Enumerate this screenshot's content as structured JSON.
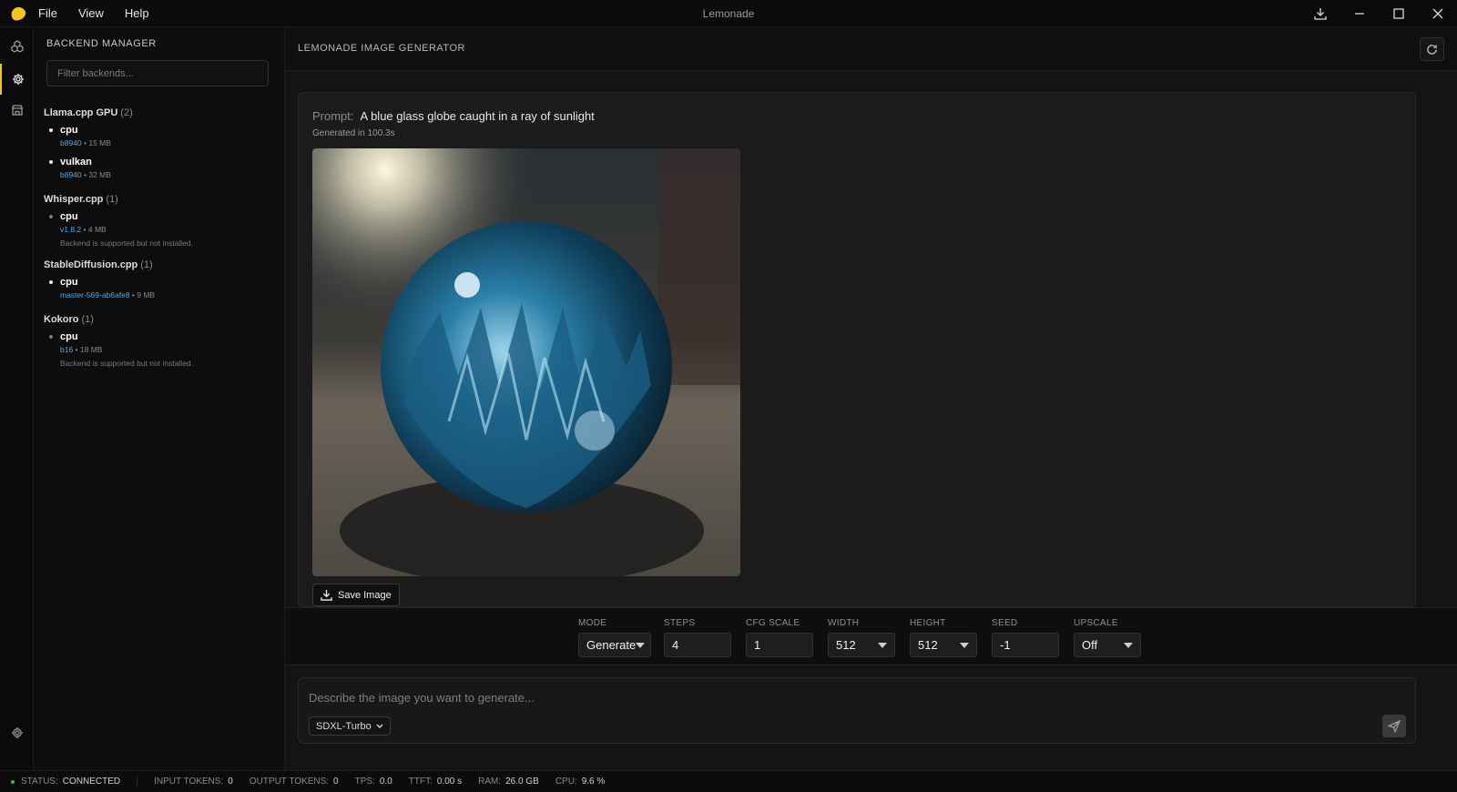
{
  "window": {
    "title": "Lemonade",
    "menu": [
      "File",
      "View",
      "Help"
    ]
  },
  "sidebar": {
    "title": "BACKEND MANAGER",
    "filter_placeholder": "Filter backends...",
    "groups": [
      {
        "name": "Llama.cpp GPU",
        "count": "(2)",
        "backends": [
          {
            "name": "cpu",
            "version": "b8940",
            "size": "15 MB",
            "installed": true,
            "note": ""
          },
          {
            "name": "vulkan",
            "version": "b8940",
            "size": "32 MB",
            "installed": true,
            "note": ""
          }
        ]
      },
      {
        "name": "Whisper.cpp",
        "count": "(1)",
        "backends": [
          {
            "name": "cpu",
            "version": "v1.8.2",
            "size": "4 MB",
            "installed": false,
            "note": "Backend is supported but not installed."
          }
        ]
      },
      {
        "name": "StableDiffusion.cpp",
        "count": "(1)",
        "backends": [
          {
            "name": "cpu",
            "version": "master-569-ab6afe8",
            "size": "9 MB",
            "installed": true,
            "note": ""
          }
        ]
      },
      {
        "name": "Kokoro",
        "count": "(1)",
        "backends": [
          {
            "name": "cpu",
            "version": "b16",
            "size": "18 MB",
            "installed": false,
            "note": "Backend is supported but not installed."
          }
        ]
      }
    ]
  },
  "main": {
    "title": "LEMONADE IMAGE GENERATOR",
    "prompt_label": "Prompt:",
    "prompt_text": "A blue glass globe caught in a ray of sunlight",
    "generated_time": "Generated in 100.3s",
    "save_label": "Save Image"
  },
  "controls": {
    "mode": {
      "label": "MODE",
      "value": "Generate"
    },
    "steps": {
      "label": "STEPS",
      "value": "4"
    },
    "cfg": {
      "label": "CFG SCALE",
      "value": "1"
    },
    "width": {
      "label": "WIDTH",
      "value": "512"
    },
    "height": {
      "label": "HEIGHT",
      "value": "512"
    },
    "seed": {
      "label": "SEED",
      "value": "-1"
    },
    "upscale": {
      "label": "UPSCALE",
      "value": "Off"
    }
  },
  "input": {
    "placeholder": "Describe the image you want to generate...",
    "model": "SDXL-Turbo"
  },
  "status": {
    "status_label": "STATUS:",
    "status_value": "CONNECTED",
    "input_tokens_label": "INPUT TOKENS:",
    "input_tokens": "0",
    "output_tokens_label": "OUTPUT TOKENS:",
    "output_tokens": "0",
    "tps_label": "TPS:",
    "tps": "0.0",
    "ttft_label": "TTFT:",
    "ttft": "0.00 s",
    "ram_label": "RAM:",
    "ram": "26.0 GB",
    "cpu_label": "CPU:",
    "cpu": "9.6 %"
  },
  "colors": {
    "accent": "#f4c51b",
    "link": "#5fa6d9",
    "status_ok": "#25c25a"
  }
}
